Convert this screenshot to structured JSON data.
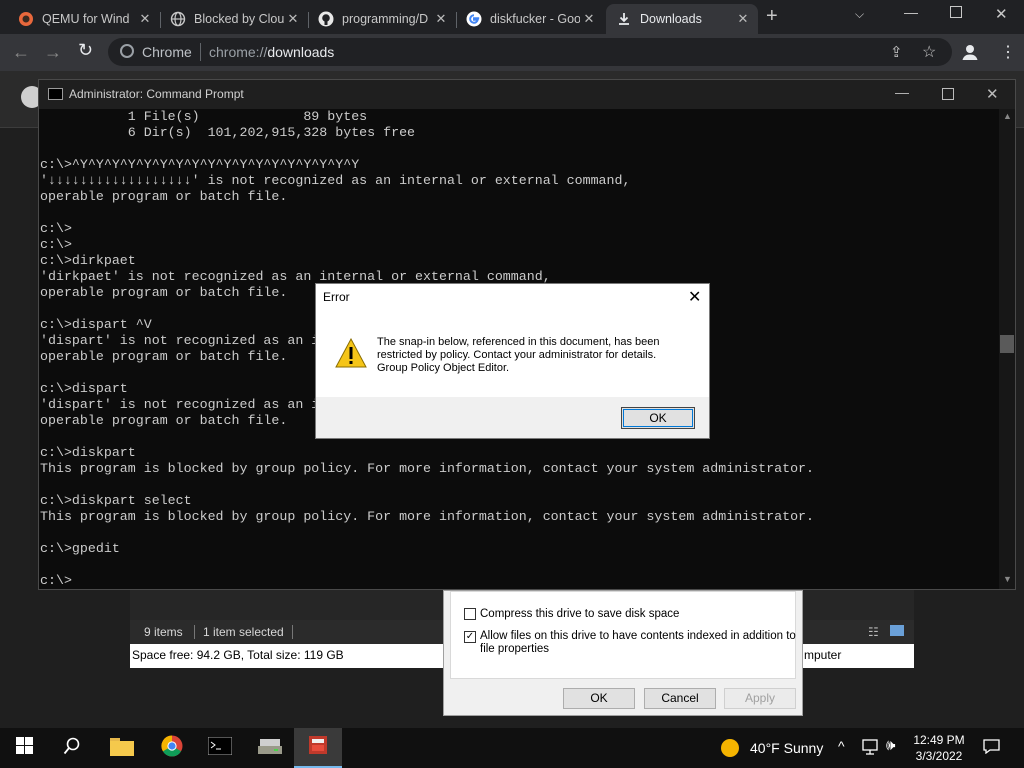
{
  "browser": {
    "tabs": [
      {
        "title": "QEMU for Wind",
        "icon": "qemu-icon"
      },
      {
        "title": "Blocked by Clou",
        "icon": "globe-icon"
      },
      {
        "title": "programming/D",
        "icon": "github-icon"
      },
      {
        "title": "diskfucker - Goo",
        "icon": "google-icon"
      },
      {
        "title": "Downloads",
        "icon": "download-icon",
        "active": true
      }
    ],
    "new_tab": "+",
    "address_scheme": "Chrome",
    "address_prefix": "chrome://",
    "address_path": "downloads"
  },
  "cmd": {
    "title": "Administrator: Command Prompt",
    "lines": [
      "           1 File(s)             89 bytes",
      "           6 Dir(s)  101,202,915,328 bytes free",
      "",
      "c:\\>^Y^Y^Y^Y^Y^Y^Y^Y^Y^Y^Y^Y^Y^Y^Y^Y^Y^Y",
      "'↓↓↓↓↓↓↓↓↓↓↓↓↓↓↓↓↓↓' is not recognized as an internal or external command,",
      "operable program or batch file.",
      "",
      "c:\\>",
      "c:\\>",
      "c:\\>dirkpaet",
      "'dirkpaet' is not recognized as an internal or external command,",
      "operable program or batch file.",
      "",
      "c:\\>dispart ^V",
      "'dispart' is not recognized as an internal or external command,",
      "operable program or batch file.",
      "",
      "c:\\>dispart",
      "'dispart' is not recognized as an internal or external command,",
      "operable program or batch file.",
      "",
      "c:\\>diskpart",
      "This program is blocked by group policy. For more information, contact your system administrator.",
      "",
      "c:\\>diskpart select",
      "This program is blocked by group policy. For more information, contact your system administrator.",
      "",
      "c:\\>gpedit",
      "",
      "c:\\>"
    ]
  },
  "error_dialog": {
    "title": "Error",
    "message_lines": [
      "The snap-in below, referenced in this document, has been",
      "restricted by policy. Contact your administrator for details.",
      "Group Policy Object Editor."
    ],
    "ok_label": "OK"
  },
  "explorer": {
    "item_count": "9 items",
    "selected": "1 item selected",
    "space_info": "Space free: 94.2 GB, Total size: 119 GB",
    "location_partial": "mputer"
  },
  "properties_dialog": {
    "compress_label": "Compress this drive to save disk space",
    "compress_checked": false,
    "index_label_line1": "Allow files on this drive to have contents indexed in addition to",
    "index_label_line2": "file properties",
    "index_checked": true,
    "ok_label": "OK",
    "cancel_label": "Cancel",
    "apply_label": "Apply"
  },
  "taskbar": {
    "weather_temp": "40°F",
    "weather_desc": "Sunny",
    "time": "12:49 PM",
    "date": "3/3/2022"
  },
  "colors": {
    "cmd_bg": "#0c0c0c",
    "cmd_text": "#cccccc",
    "chrome_dark": "#202124",
    "taskbar": "#101010"
  }
}
